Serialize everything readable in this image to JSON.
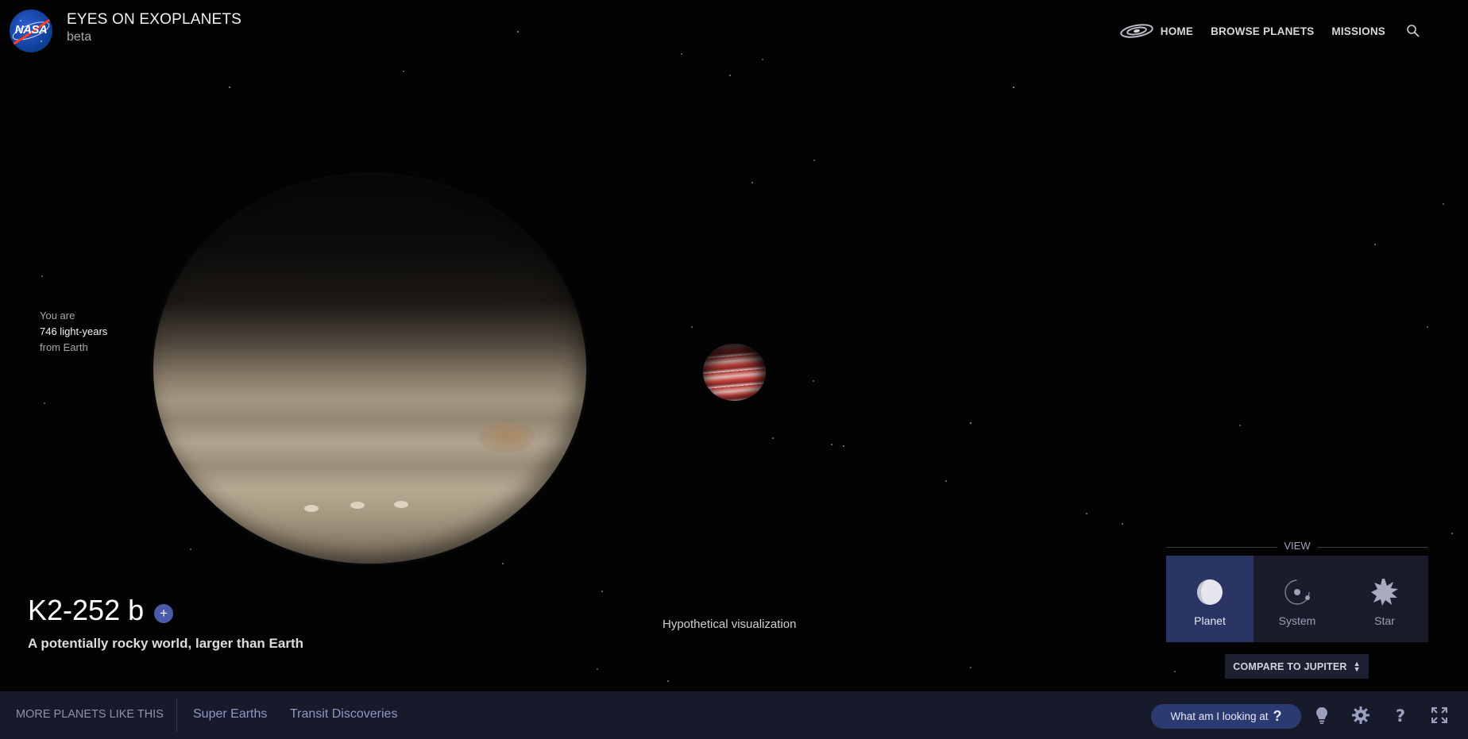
{
  "header": {
    "logo_text": "NASA",
    "app_title": "EYES ON EXOPLANETS",
    "app_subtitle": "beta"
  },
  "nav": {
    "home_icon": "galaxy-icon",
    "home": "HOME",
    "browse": "BROWSE PLANETS",
    "missions": "MISSIONS",
    "search_icon": "search-icon"
  },
  "distance": {
    "line1": "You are",
    "value": "746 light-years",
    "line3": "from Earth"
  },
  "planet": {
    "name": "K2-252 b",
    "add_label": "+",
    "tagline": "A potentially rocky world, larger than Earth",
    "visualization_note": "Hypothetical visualization"
  },
  "view": {
    "label": "VIEW",
    "options": [
      {
        "label": "Planet",
        "icon": "planet-icon",
        "active": true
      },
      {
        "label": "System",
        "icon": "system-icon",
        "active": false
      },
      {
        "label": "Star",
        "icon": "star-icon",
        "active": false
      }
    ],
    "compare_label": "COMPARE TO JUPITER"
  },
  "footer": {
    "more_label": "MORE PLANETS LIKE THIS",
    "tags": [
      "Super Earths",
      "Transit Discoveries"
    ],
    "what_label": "What am I looking at",
    "what_icon": "question-icon",
    "icons": [
      "lightbulb-icon",
      "gear-icon",
      "help-icon",
      "fullscreen-icon"
    ]
  },
  "colors": {
    "background": "#030304",
    "footer_bg": "#161a2a",
    "accent": "#2c3a72",
    "active_view": "#2a3565"
  }
}
